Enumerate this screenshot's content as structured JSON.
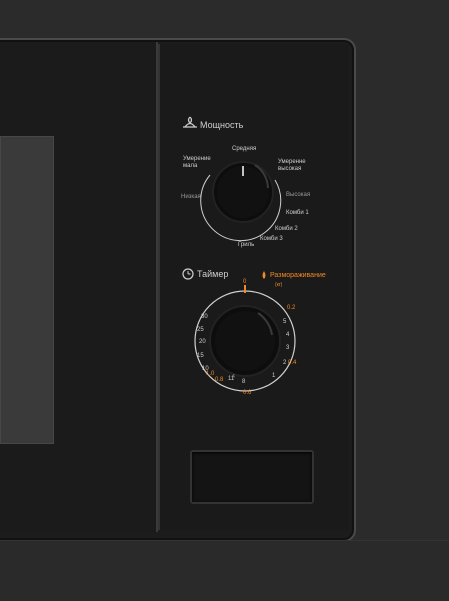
{
  "power": {
    "title": "Мощность",
    "icon": "flame-icon",
    "labels": {
      "defrost_mid": "Умерение\nмала",
      "top": "Средняя",
      "upper_right": "Умеренне\nвысокая",
      "left": "Низкая",
      "right": "Высокая",
      "combi1": "Комби 1",
      "combi2": "Комби 2",
      "combi3": "Комби 3",
      "grill": "Гриль"
    }
  },
  "timer": {
    "title": "Таймер",
    "icon": "clock-icon",
    "defrost_label": "Размораживание",
    "defrost_unit": "(кг)",
    "defrost_icon": "drop-icon",
    "white_ticks": [
      "30",
      "25",
      "20",
      "15",
      "10",
      "5",
      "4",
      "3",
      "2",
      "1",
      "11",
      "8",
      "6",
      "4"
    ],
    "orange_ticks": [
      "0",
      "0.2",
      "0.4",
      "0.6",
      "0.8",
      "1.0"
    ]
  },
  "colors": {
    "accent": "#f08a24",
    "text": "#cfcfcf",
    "bg": "#1a1a1a"
  }
}
